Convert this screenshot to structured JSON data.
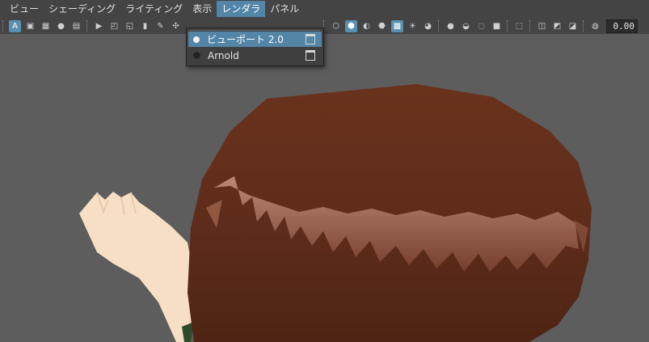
{
  "menubar": {
    "items": [
      {
        "label": "ビュー"
      },
      {
        "label": "シェーディング"
      },
      {
        "label": "ライティング"
      },
      {
        "label": "表示"
      },
      {
        "label": "レンダラ"
      },
      {
        "label": "パネル"
      }
    ],
    "active_item": "レンダラ"
  },
  "toolbar": {
    "icons_left": [
      "camera-select-icon",
      "grid-a-icon",
      "frame-all-icon",
      "frame-selection-icon",
      "sphere-icon",
      "film-gate-icon"
    ],
    "field_value": "0.00"
  },
  "renderer_menu": {
    "items": [
      {
        "label": "ビューポート 2.0",
        "selected": true
      },
      {
        "label": "Arnold",
        "selected": false
      }
    ]
  },
  "colors": {
    "accent": "#5285a6",
    "hair": "#6b3520",
    "skin": "#f6dcc0",
    "viewport_bg": "#5d5d5d"
  }
}
